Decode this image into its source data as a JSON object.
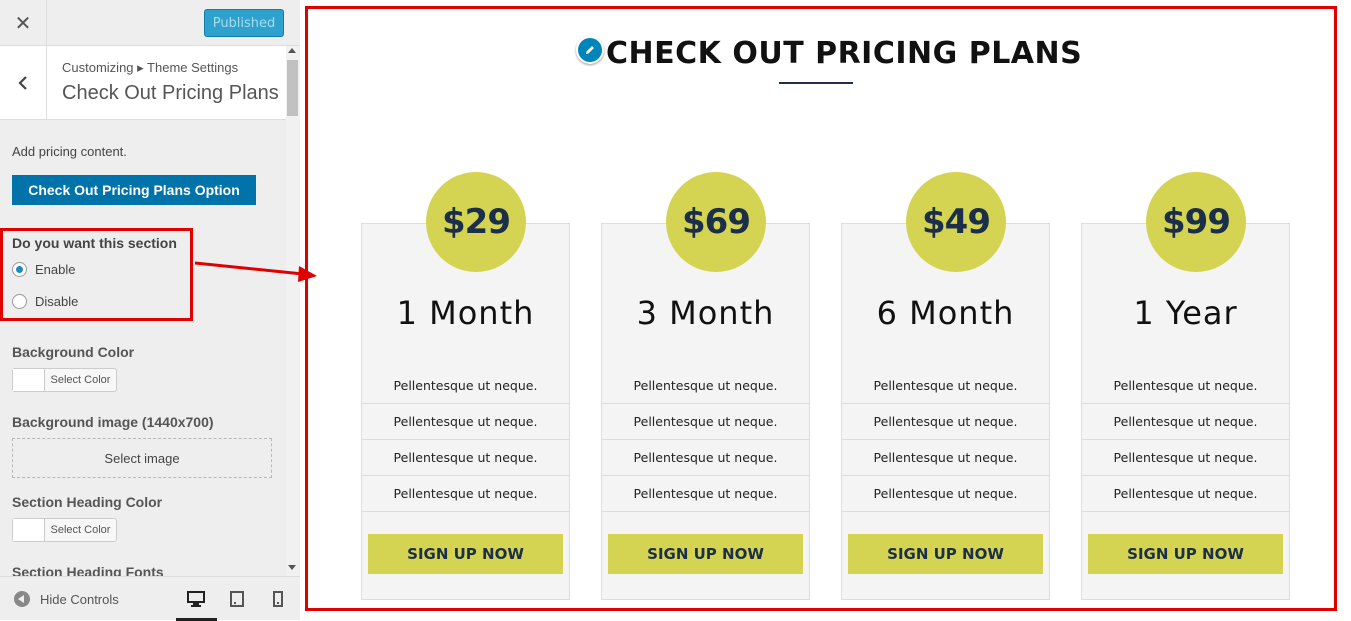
{
  "topbar": {
    "close_icon": "close-icon",
    "publish_label": "Published"
  },
  "header": {
    "breadcrumb": "Customizing ▸ Theme Settings",
    "title": "Check Out Pricing Plans"
  },
  "panel": {
    "description": "Add pricing content.",
    "option_button": "Check Out Pricing Plans Option",
    "section_toggle": {
      "label": "Do you want this section",
      "options": [
        "Enable",
        "Disable"
      ],
      "selected": "Enable"
    },
    "background_color": {
      "label": "Background Color",
      "button": "Select Color"
    },
    "background_image": {
      "label": "Background image (1440x700)",
      "button": "Select image"
    },
    "heading_color": {
      "label": "Section Heading Color",
      "button": "Select Color"
    },
    "heading_fonts": {
      "label": "Section Heading Fonts"
    }
  },
  "footer": {
    "hide_controls": "Hide Controls",
    "devices": [
      "desktop-icon",
      "tablet-icon",
      "mobile-icon"
    ],
    "active_device": "desktop"
  },
  "preview": {
    "heading": "CHECK OUT PRICING PLANS",
    "plans": [
      {
        "price": "$29",
        "period": "1 Month",
        "features": [
          "Pellentesque ut neque.",
          "Pellentesque ut neque.",
          "Pellentesque ut neque.",
          "Pellentesque ut neque."
        ],
        "cta": "SIGN UP NOW"
      },
      {
        "price": "$69",
        "period": "3 Month",
        "features": [
          "Pellentesque ut neque.",
          "Pellentesque ut neque.",
          "Pellentesque ut neque.",
          "Pellentesque ut neque."
        ],
        "cta": "SIGN UP NOW"
      },
      {
        "price": "$49",
        "period": "6 Month",
        "features": [
          "Pellentesque ut neque.",
          "Pellentesque ut neque.",
          "Pellentesque ut neque.",
          "Pellentesque ut neque."
        ],
        "cta": "SIGN UP NOW"
      },
      {
        "price": "$99",
        "period": "1 Year",
        "features": [
          "Pellentesque ut neque.",
          "Pellentesque ut neque.",
          "Pellentesque ut neque.",
          "Pellentesque ut neque."
        ],
        "cta": "SIGN UP NOW"
      }
    ]
  },
  "colors": {
    "accent": "#d4d452",
    "navy": "#1b2f4a",
    "primary_button": "#0073aa",
    "annotation": "#e00000"
  }
}
